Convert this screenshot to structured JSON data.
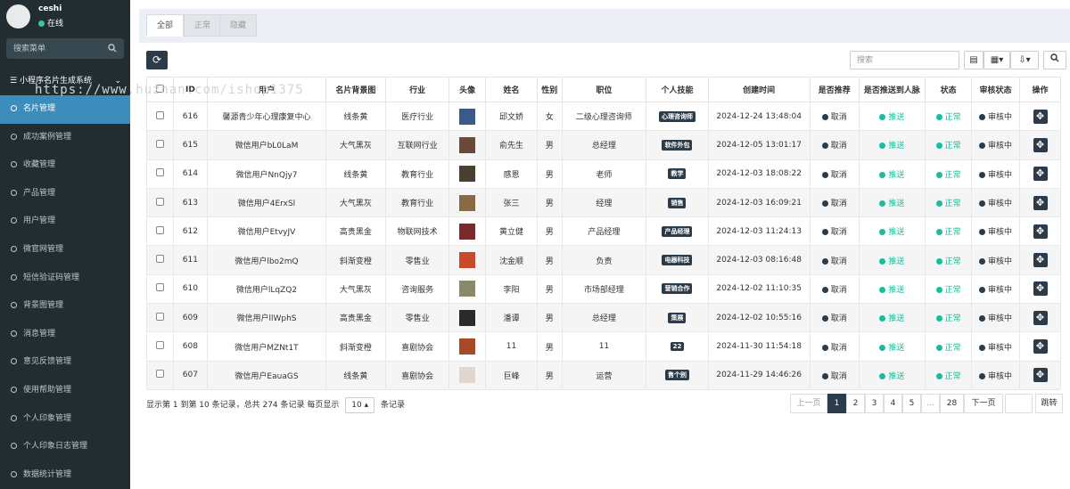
{
  "sidebar": {
    "username": "ceshi",
    "status": "在线",
    "search_placeholder": "搜索菜单",
    "menu_title": "小程序名片生成系统",
    "items": [
      "名片管理",
      "成功案例管理",
      "收藏管理",
      "产品管理",
      "用户管理",
      "微官网管理",
      "短信验证码管理",
      "背景图管理",
      "消息管理",
      "意见反馈管理",
      "使用帮助管理",
      "个人印象管理",
      "个人印象日志管理",
      "数据统计管理"
    ],
    "watermark": "https://www.huzhan.com/ishop1375"
  },
  "tabs": [
    "全部",
    "正常",
    "隐藏"
  ],
  "toolbar": {
    "search_placeholder": "搜索"
  },
  "table": {
    "columns": [
      "ID",
      "用户",
      "名片背景图",
      "行业",
      "头像",
      "姓名",
      "性别",
      "职位",
      "个人技能",
      "创建时间",
      "是否推荐",
      "是否推送到人脉",
      "状态",
      "审核状态",
      "操作"
    ],
    "rows": [
      {
        "id": "616",
        "user": "馨源青少年心理康复中心",
        "bg": "线条黄",
        "industry": "医疗行业",
        "name": "邱文娇",
        "gender": "女",
        "position": "二级心理咨询师",
        "skill": "心理咨询师",
        "time": "2024-12-24 13:48:04"
      },
      {
        "id": "615",
        "user": "微信用户bL0LaM",
        "bg": "大气黑灰",
        "industry": "互联网行业",
        "name": "俞先生",
        "gender": "男",
        "position": "总经理",
        "skill": "软件外包",
        "time": "2024-12-05 13:01:17"
      },
      {
        "id": "614",
        "user": "微信用户NnQjy7",
        "bg": "线条黄",
        "industry": "教育行业",
        "name": "感恩",
        "gender": "男",
        "position": "老师",
        "skill": "教学",
        "time": "2024-12-03 18:08:22"
      },
      {
        "id": "613",
        "user": "微信用户4ErxSl",
        "bg": "大气黑灰",
        "industry": "教育行业",
        "name": "张三",
        "gender": "男",
        "position": "经理",
        "skill": "销售",
        "time": "2024-12-03 16:09:21"
      },
      {
        "id": "612",
        "user": "微信用户EtvyJV",
        "bg": "高贵黑金",
        "industry": "物联网技术",
        "name": "黄立健",
        "gender": "男",
        "position": "产品经理",
        "skill": "产品经理",
        "time": "2024-12-03 11:24:13"
      },
      {
        "id": "611",
        "user": "微信用户lbo2mQ",
        "bg": "斜渐变橙",
        "industry": "零售业",
        "name": "沈金顺",
        "gender": "男",
        "position": "负责",
        "skill": "电器科技",
        "time": "2024-12-03 08:16:48"
      },
      {
        "id": "610",
        "user": "微信用户lLqZQ2",
        "bg": "大气黑灰",
        "industry": "咨询服务",
        "name": "李阳",
        "gender": "男",
        "position": "市场部经理",
        "skill": "营销合作",
        "time": "2024-12-02 11:10:35"
      },
      {
        "id": "609",
        "user": "微信用户llWphS",
        "bg": "高贵黑金",
        "industry": "零售业",
        "name": "潘谭",
        "gender": "男",
        "position": "总经理",
        "skill": "策展",
        "time": "2024-12-02 10:55:16"
      },
      {
        "id": "608",
        "user": "微信用户MZNt1T",
        "bg": "斜渐变橙",
        "industry": "喜剧协会",
        "name": "11",
        "gender": "男",
        "position": "11",
        "skill": "22",
        "time": "2024-11-30 11:54:18"
      },
      {
        "id": "607",
        "user": "微信用户EauaGS",
        "bg": "线条黄",
        "industry": "喜剧协会",
        "name": "巨峰",
        "gender": "男",
        "position": "运营",
        "skill": "售个别",
        "time": "2024-11-29 14:46:26"
      }
    ],
    "recommend_label": "取消",
    "push_label": "推送",
    "status_label": "正常",
    "audit_label": "审核中"
  },
  "footer": {
    "info_prefix": "显示第 1 到第 10 条记录，总共 274 条记录 每页显示",
    "page_size": "10",
    "info_suffix": "条记录",
    "prev": "上一页",
    "pages": [
      "1",
      "2",
      "3",
      "4",
      "5",
      "...",
      "28"
    ],
    "next": "下一页",
    "jump": "跳转"
  },
  "colors": {
    "sidebar_bg": "#222d32",
    "active_menu": "#3c8dbc",
    "accent_dark": "#2c3b4a",
    "ok_green": "#1abc9c"
  }
}
